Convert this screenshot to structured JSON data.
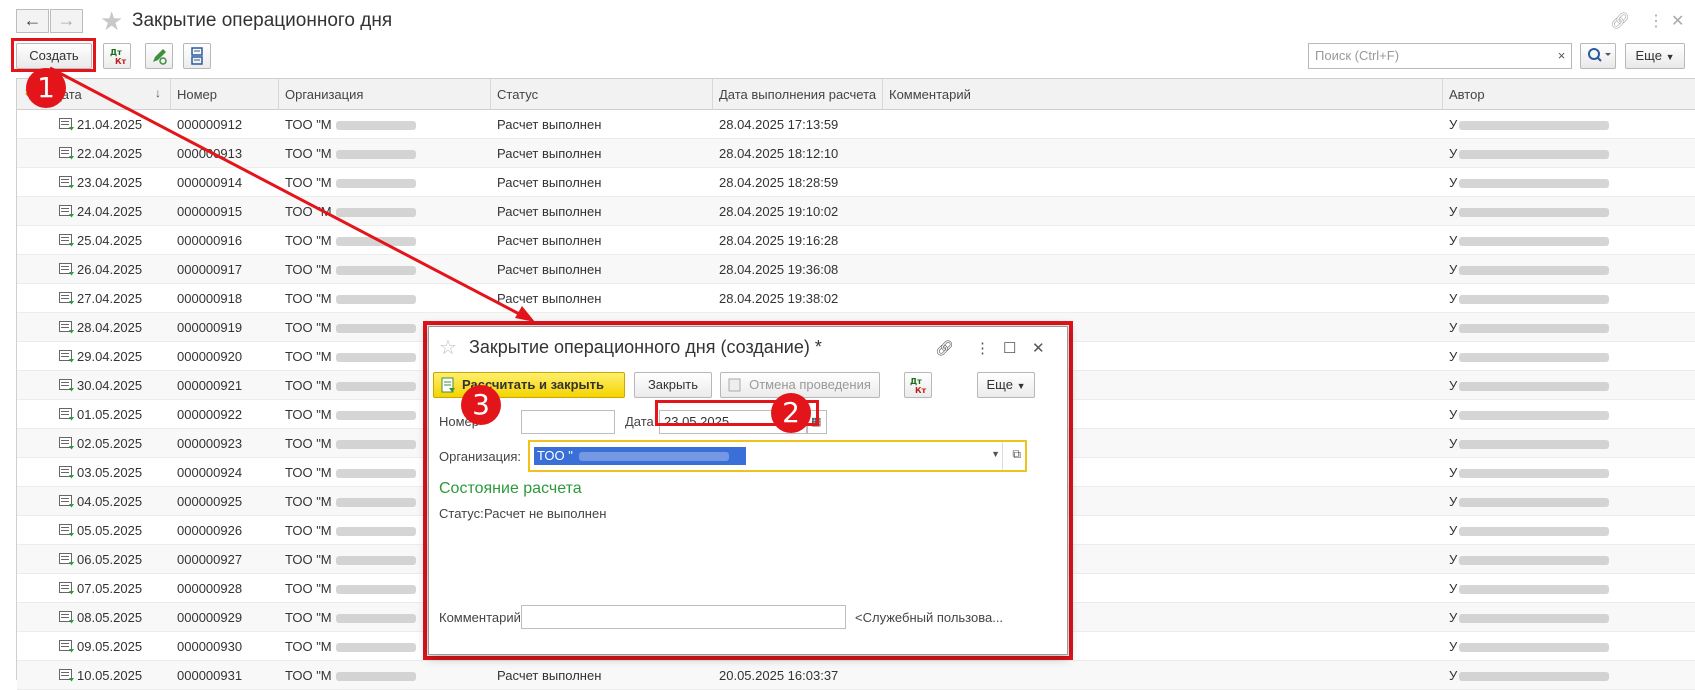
{
  "window": {
    "title": "Закрытие операционного дня"
  },
  "toolbar": {
    "create_label": "Создать",
    "search_placeholder": "Поиск (Ctrl+F)",
    "search_clear": "×",
    "more_label": "Еще"
  },
  "grid": {
    "columns": [
      "Дата",
      "Номер",
      "Организация",
      "Статус",
      "Дата выполнения расчета",
      "Комментарий",
      "Автор"
    ],
    "rows": [
      {
        "date": "21.04.2025",
        "number": "000000912",
        "org": "ТОО \"М",
        "status": "Расчет выполнен",
        "calc_date": "28.04.2025 17:13:59",
        "author": "У"
      },
      {
        "date": "22.04.2025",
        "number": "000000913",
        "org": "ТОО \"М",
        "status": "Расчет выполнен",
        "calc_date": "28.04.2025 18:12:10",
        "author": "У"
      },
      {
        "date": "23.04.2025",
        "number": "000000914",
        "org": "ТОО \"М",
        "status": "Расчет выполнен",
        "calc_date": "28.04.2025 18:28:59",
        "author": "У"
      },
      {
        "date": "24.04.2025",
        "number": "000000915",
        "org": "ТОО \"М",
        "status": "Расчет выполнен",
        "calc_date": "28.04.2025 19:10:02",
        "author": "У"
      },
      {
        "date": "25.04.2025",
        "number": "000000916",
        "org": "ТОО \"М",
        "status": "Расчет выполнен",
        "calc_date": "28.04.2025 19:16:28",
        "author": "У"
      },
      {
        "date": "26.04.2025",
        "number": "000000917",
        "org": "ТОО \"М",
        "status": "Расчет выполнен",
        "calc_date": "28.04.2025 19:36:08",
        "author": "У"
      },
      {
        "date": "27.04.2025",
        "number": "000000918",
        "org": "ТОО \"М",
        "status": "Расчет выполнен",
        "calc_date": "28.04.2025 19:38:02",
        "author": "У"
      },
      {
        "date": "28.04.2025",
        "number": "000000919",
        "org": "ТОО \"М",
        "status": "",
        "calc_date": "",
        "author": "У"
      },
      {
        "date": "29.04.2025",
        "number": "000000920",
        "org": "ТОО \"М",
        "status": "",
        "calc_date": "",
        "author": "У"
      },
      {
        "date": "30.04.2025",
        "number": "000000921",
        "org": "ТОО \"М",
        "status": "",
        "calc_date": "",
        "author": "У"
      },
      {
        "date": "01.05.2025",
        "number": "000000922",
        "org": "ТОО \"М",
        "status": "",
        "calc_date": "",
        "author": "У"
      },
      {
        "date": "02.05.2025",
        "number": "000000923",
        "org": "ТОО \"М",
        "status": "",
        "calc_date": "",
        "author": "У"
      },
      {
        "date": "03.05.2025",
        "number": "000000924",
        "org": "ТОО \"М",
        "status": "",
        "calc_date": "",
        "author": "У"
      },
      {
        "date": "04.05.2025",
        "number": "000000925",
        "org": "ТОО \"М",
        "status": "",
        "calc_date": "",
        "author": "У"
      },
      {
        "date": "05.05.2025",
        "number": "000000926",
        "org": "ТОО \"М",
        "status": "",
        "calc_date": "",
        "author": "У"
      },
      {
        "date": "06.05.2025",
        "number": "000000927",
        "org": "ТОО \"М",
        "status": "",
        "calc_date": "",
        "author": "У"
      },
      {
        "date": "07.05.2025",
        "number": "000000928",
        "org": "ТОО \"М",
        "status": "",
        "calc_date": "",
        "author": "У"
      },
      {
        "date": "08.05.2025",
        "number": "000000929",
        "org": "ТОО \"М",
        "status": "",
        "calc_date": "",
        "author": "У"
      },
      {
        "date": "09.05.2025",
        "number": "000000930",
        "org": "ТОО \"М",
        "status": "",
        "calc_date": "",
        "author": "У"
      },
      {
        "date": "10.05.2025",
        "number": "000000931",
        "org": "ТОО \"М",
        "status": "Расчет выполнен",
        "calc_date": "20.05.2025 16:03:37",
        "author": "У"
      }
    ]
  },
  "dialog": {
    "title": "Закрытие операционного дня (создание) *",
    "calc_close_label": "Рассчитать и закрыть",
    "close_label": "Закрыть",
    "unpost_label": "Отмена проведения",
    "more_label": "Еще",
    "number_label": "Номер",
    "number_value": "",
    "date_label": "Дата:",
    "date_value": "23.05.2025",
    "org_label": "Организация:",
    "org_value": "ТОО \"",
    "section_title": "Состояние расчета",
    "status_label": "Статус:",
    "status_value": "Расчет не выполнен",
    "comment_label": "Комментарий:",
    "comment_value": "",
    "author_value": "<Служебный пользова..."
  },
  "annotations": {
    "one": "1",
    "two": "2",
    "three": "3"
  },
  "colors": {
    "annotation": "#e4141b",
    "primary_button": "#f5d400",
    "section_title": "#2d9a3a"
  }
}
